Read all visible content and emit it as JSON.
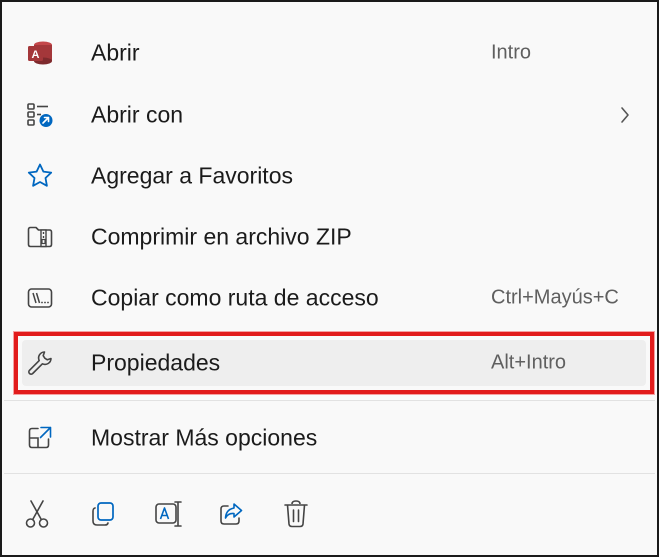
{
  "menu": {
    "items": [
      {
        "label": "Abrir",
        "shortcut": "Intro",
        "icon": "access-app-icon"
      },
      {
        "label": "Abrir con",
        "shortcut": "",
        "icon": "open-with-icon",
        "has_submenu": true
      },
      {
        "label": "Agregar a Favoritos",
        "shortcut": "",
        "icon": "star-icon"
      },
      {
        "label": "Comprimir en archivo ZIP",
        "shortcut": "",
        "icon": "zip-folder-icon"
      },
      {
        "label": "Copiar como ruta de acceso",
        "shortcut": "Ctrl+Mayús+C",
        "icon": "copy-path-icon"
      },
      {
        "label": "Propiedades",
        "shortcut": "Alt+Intro",
        "icon": "wrench-icon",
        "highlighted": true
      },
      {
        "label": "Mostrar Más opciones",
        "shortcut": "",
        "icon": "more-options-icon"
      }
    ],
    "toolbar": [
      {
        "icon": "cut-icon"
      },
      {
        "icon": "copy-icon"
      },
      {
        "icon": "rename-icon"
      },
      {
        "icon": "share-icon"
      },
      {
        "icon": "delete-icon"
      }
    ]
  },
  "colors": {
    "highlight_border": "#e21b1b",
    "access_red": "#a4373a",
    "accent_blue": "#0067c0"
  }
}
